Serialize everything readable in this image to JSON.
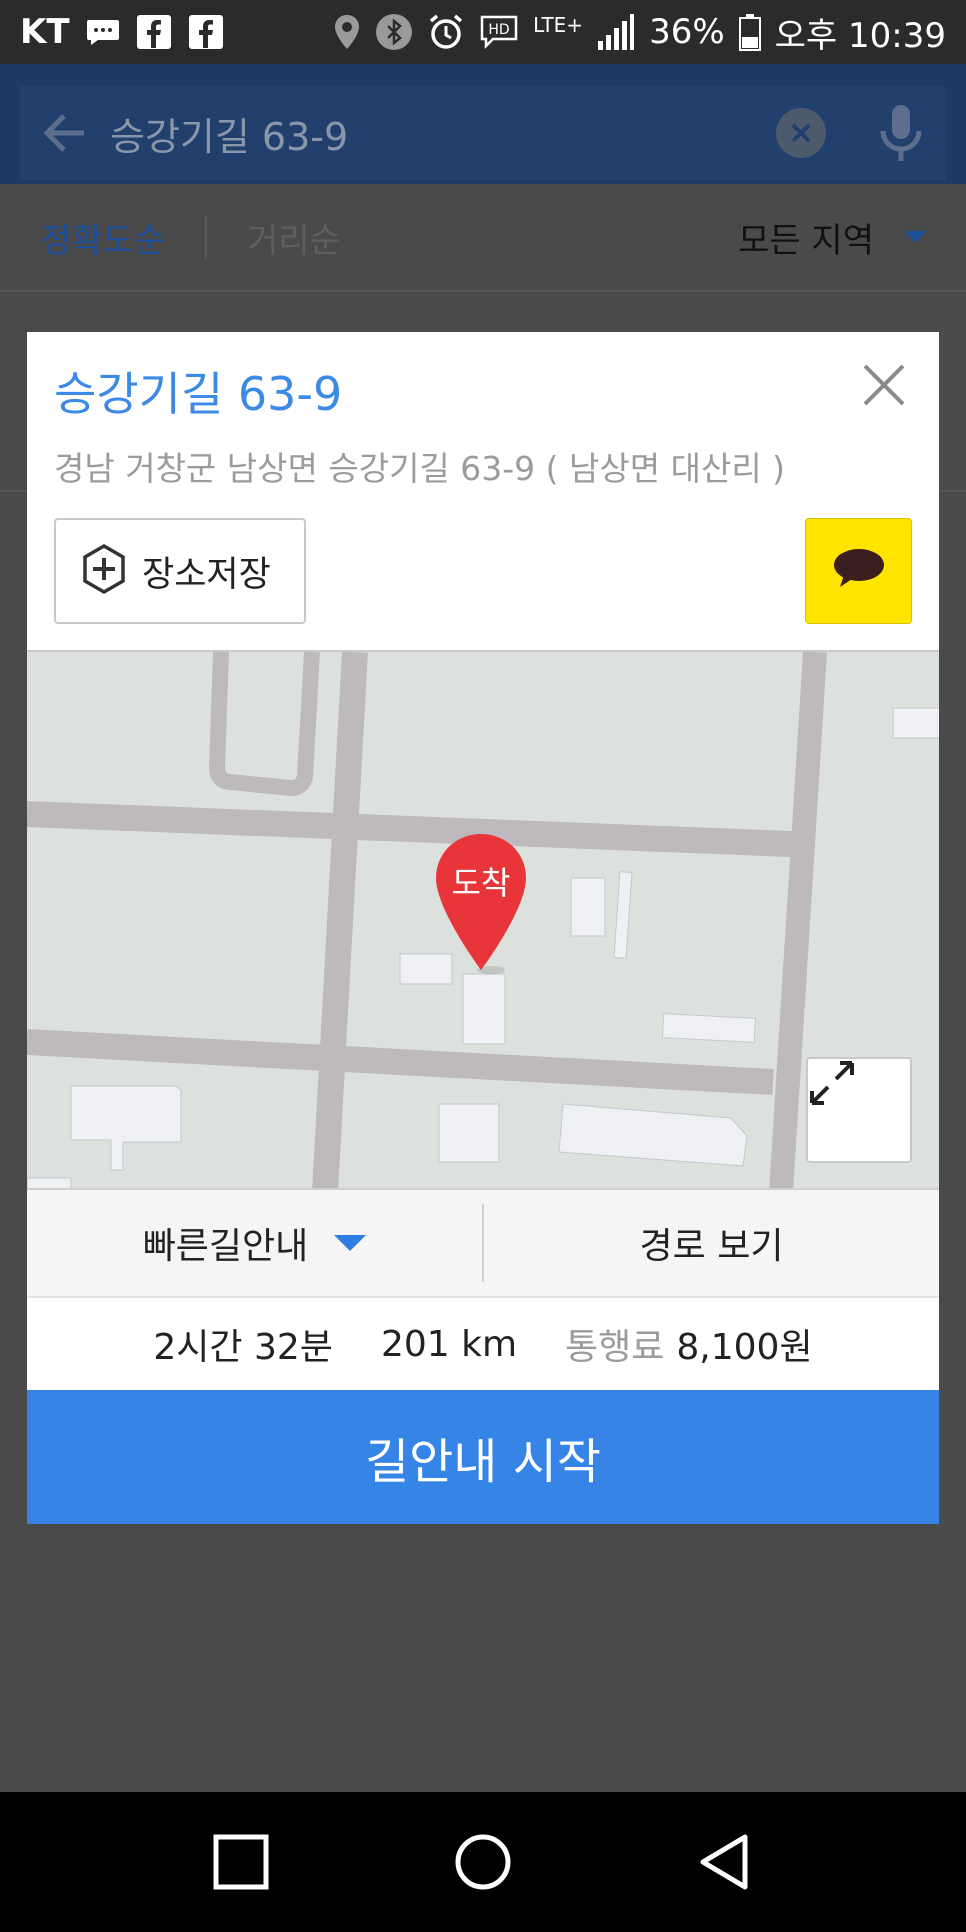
{
  "status_bar": {
    "carrier": "KT",
    "network": "LTE+",
    "battery": "36%",
    "time": "오후 10:39"
  },
  "search": {
    "query": "승강기길 63-9"
  },
  "sort": {
    "accuracy": "정확도순",
    "distance": "거리순",
    "region": "모든 지역"
  },
  "dialog": {
    "title": "승강기길 63-9",
    "address": "경남 거창군 남상면 승강기길 63-9 ( 남상면 대산리 )",
    "save_label": "장소저장",
    "pin_label": "도착",
    "route_option": "빠른길안내",
    "view_route": "경로 보기",
    "duration": "2시간 32분",
    "distance": "201 km",
    "toll_label": "통행료",
    "toll_value": "8,100원",
    "start_button": "길안내 시작"
  },
  "colors": {
    "accent": "#3685e6",
    "title_blue": "#3d8ae5",
    "kakao_yellow": "#ffe400",
    "pin_red": "#e8353a"
  }
}
